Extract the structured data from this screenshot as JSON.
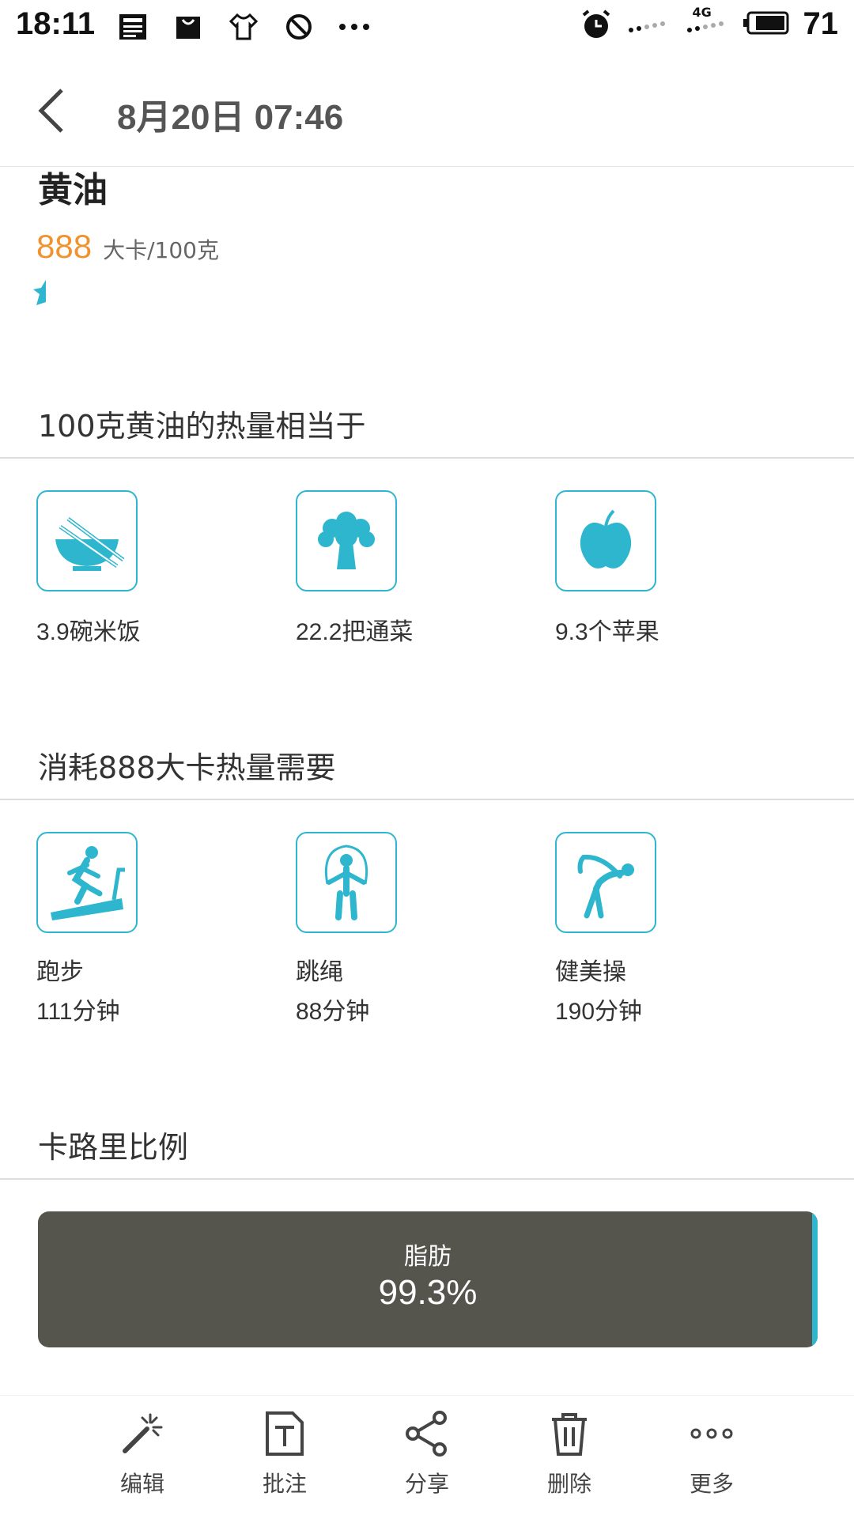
{
  "status_bar": {
    "time": "18:11",
    "network": "4G",
    "battery": "71",
    "icons": [
      "news-icon",
      "bag-icon",
      "shirt-icon",
      "blocked-icon",
      "more-dots-icon",
      "alarm-icon",
      "signal-icon",
      "battery-icon"
    ]
  },
  "header": {
    "title": "8月20日 07:46"
  },
  "food": {
    "name": "黄油",
    "calories": "888",
    "unit": "大卡/100克"
  },
  "equivalent": {
    "title": "100克黄油的热量相当于",
    "items": [
      {
        "icon": "rice-bowl-icon",
        "label": "3.9碗米饭"
      },
      {
        "icon": "broccoli-icon",
        "label": "22.2把通菜"
      },
      {
        "icon": "apple-icon",
        "label": "9.3个苹果"
      }
    ]
  },
  "exercise": {
    "title": "消耗888大卡热量需要",
    "items": [
      {
        "icon": "treadmill-icon",
        "name": "跑步",
        "time": "111分钟"
      },
      {
        "icon": "jump-rope-icon",
        "name": "跳绳",
        "time": "88分钟"
      },
      {
        "icon": "aerobics-icon",
        "name": "健美操",
        "time": "190分钟"
      }
    ]
  },
  "ratio": {
    "title": "卡路里比例",
    "name": "脂肪",
    "percent": "99.3%",
    "fat_fraction": 0.993,
    "colors": {
      "fat": "#55554d",
      "other": "#2fb6cf"
    }
  },
  "bottom_bar": {
    "items": [
      {
        "icon": "magic-wand-icon",
        "label": "编辑"
      },
      {
        "icon": "text-note-icon",
        "label": "批注"
      },
      {
        "icon": "share-icon",
        "label": "分享"
      },
      {
        "icon": "trash-icon",
        "label": "删除"
      },
      {
        "icon": "more-icon",
        "label": "更多"
      }
    ]
  },
  "accent_color": "#2fb6cf",
  "calorie_color": "#f0922e"
}
